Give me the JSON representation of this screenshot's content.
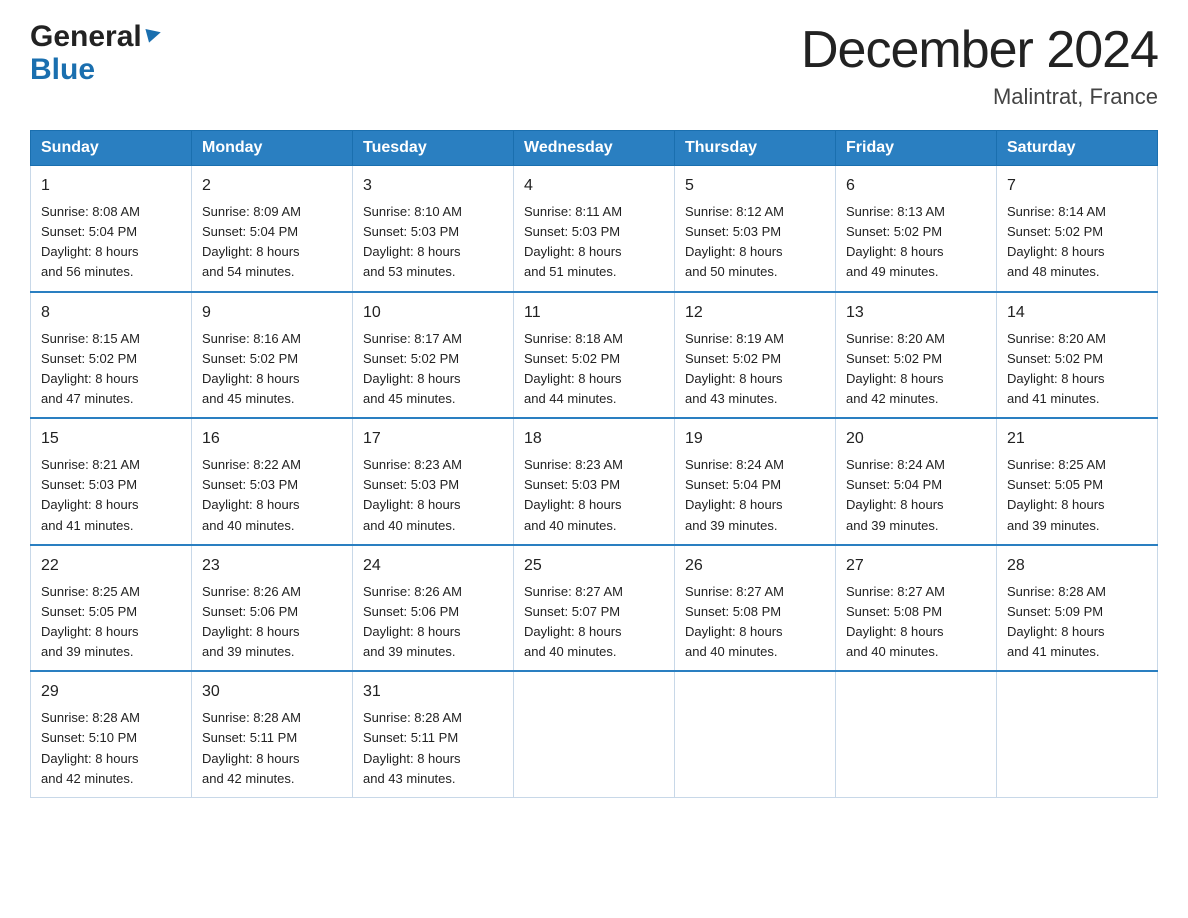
{
  "logo": {
    "line1": "General",
    "arrow": "▶",
    "line2": "Blue"
  },
  "title": "December 2024",
  "subtitle": "Malintrat, France",
  "days": [
    "Sunday",
    "Monday",
    "Tuesday",
    "Wednesday",
    "Thursday",
    "Friday",
    "Saturday"
  ],
  "weeks": [
    [
      {
        "num": "1",
        "sunrise": "8:08 AM",
        "sunset": "5:04 PM",
        "daylight": "8 hours and 56 minutes."
      },
      {
        "num": "2",
        "sunrise": "8:09 AM",
        "sunset": "5:04 PM",
        "daylight": "8 hours and 54 minutes."
      },
      {
        "num": "3",
        "sunrise": "8:10 AM",
        "sunset": "5:03 PM",
        "daylight": "8 hours and 53 minutes."
      },
      {
        "num": "4",
        "sunrise": "8:11 AM",
        "sunset": "5:03 PM",
        "daylight": "8 hours and 51 minutes."
      },
      {
        "num": "5",
        "sunrise": "8:12 AM",
        "sunset": "5:03 PM",
        "daylight": "8 hours and 50 minutes."
      },
      {
        "num": "6",
        "sunrise": "8:13 AM",
        "sunset": "5:02 PM",
        "daylight": "8 hours and 49 minutes."
      },
      {
        "num": "7",
        "sunrise": "8:14 AM",
        "sunset": "5:02 PM",
        "daylight": "8 hours and 48 minutes."
      }
    ],
    [
      {
        "num": "8",
        "sunrise": "8:15 AM",
        "sunset": "5:02 PM",
        "daylight": "8 hours and 47 minutes."
      },
      {
        "num": "9",
        "sunrise": "8:16 AM",
        "sunset": "5:02 PM",
        "daylight": "8 hours and 45 minutes."
      },
      {
        "num": "10",
        "sunrise": "8:17 AM",
        "sunset": "5:02 PM",
        "daylight": "8 hours and 45 minutes."
      },
      {
        "num": "11",
        "sunrise": "8:18 AM",
        "sunset": "5:02 PM",
        "daylight": "8 hours and 44 minutes."
      },
      {
        "num": "12",
        "sunrise": "8:19 AM",
        "sunset": "5:02 PM",
        "daylight": "8 hours and 43 minutes."
      },
      {
        "num": "13",
        "sunrise": "8:20 AM",
        "sunset": "5:02 PM",
        "daylight": "8 hours and 42 minutes."
      },
      {
        "num": "14",
        "sunrise": "8:20 AM",
        "sunset": "5:02 PM",
        "daylight": "8 hours and 41 minutes."
      }
    ],
    [
      {
        "num": "15",
        "sunrise": "8:21 AM",
        "sunset": "5:03 PM",
        "daylight": "8 hours and 41 minutes."
      },
      {
        "num": "16",
        "sunrise": "8:22 AM",
        "sunset": "5:03 PM",
        "daylight": "8 hours and 40 minutes."
      },
      {
        "num": "17",
        "sunrise": "8:23 AM",
        "sunset": "5:03 PM",
        "daylight": "8 hours and 40 minutes."
      },
      {
        "num": "18",
        "sunrise": "8:23 AM",
        "sunset": "5:03 PM",
        "daylight": "8 hours and 40 minutes."
      },
      {
        "num": "19",
        "sunrise": "8:24 AM",
        "sunset": "5:04 PM",
        "daylight": "8 hours and 39 minutes."
      },
      {
        "num": "20",
        "sunrise": "8:24 AM",
        "sunset": "5:04 PM",
        "daylight": "8 hours and 39 minutes."
      },
      {
        "num": "21",
        "sunrise": "8:25 AM",
        "sunset": "5:05 PM",
        "daylight": "8 hours and 39 minutes."
      }
    ],
    [
      {
        "num": "22",
        "sunrise": "8:25 AM",
        "sunset": "5:05 PM",
        "daylight": "8 hours and 39 minutes."
      },
      {
        "num": "23",
        "sunrise": "8:26 AM",
        "sunset": "5:06 PM",
        "daylight": "8 hours and 39 minutes."
      },
      {
        "num": "24",
        "sunrise": "8:26 AM",
        "sunset": "5:06 PM",
        "daylight": "8 hours and 39 minutes."
      },
      {
        "num": "25",
        "sunrise": "8:27 AM",
        "sunset": "5:07 PM",
        "daylight": "8 hours and 40 minutes."
      },
      {
        "num": "26",
        "sunrise": "8:27 AM",
        "sunset": "5:08 PM",
        "daylight": "8 hours and 40 minutes."
      },
      {
        "num": "27",
        "sunrise": "8:27 AM",
        "sunset": "5:08 PM",
        "daylight": "8 hours and 40 minutes."
      },
      {
        "num": "28",
        "sunrise": "8:28 AM",
        "sunset": "5:09 PM",
        "daylight": "8 hours and 41 minutes."
      }
    ],
    [
      {
        "num": "29",
        "sunrise": "8:28 AM",
        "sunset": "5:10 PM",
        "daylight": "8 hours and 42 minutes."
      },
      {
        "num": "30",
        "sunrise": "8:28 AM",
        "sunset": "5:11 PM",
        "daylight": "8 hours and 42 minutes."
      },
      {
        "num": "31",
        "sunrise": "8:28 AM",
        "sunset": "5:11 PM",
        "daylight": "8 hours and 43 minutes."
      },
      null,
      null,
      null,
      null
    ]
  ],
  "labels": {
    "sunrise": "Sunrise:",
    "sunset": "Sunset:",
    "daylight": "Daylight:"
  }
}
